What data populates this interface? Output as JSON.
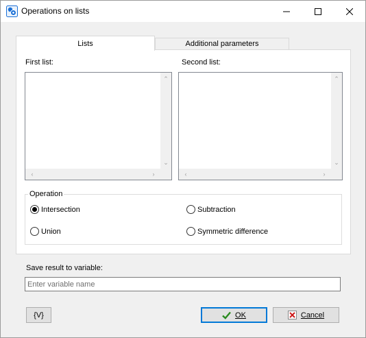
{
  "window": {
    "title": "Operations on lists",
    "icon": "operations-app-icon"
  },
  "titlebar_buttons": {
    "minimize_icon": "minimize-icon",
    "maximize_icon": "maximize-icon",
    "close_icon": "close-icon"
  },
  "tabs": [
    {
      "label": "Lists",
      "selected": true
    },
    {
      "label": "Additional parameters",
      "selected": false
    }
  ],
  "lists": {
    "first_label": "First list:",
    "second_label": "Second list:"
  },
  "operation": {
    "title": "Operation",
    "options": [
      {
        "label": "Intersection",
        "checked": true
      },
      {
        "label": "Subtraction",
        "checked": false
      },
      {
        "label": "Union",
        "checked": false
      },
      {
        "label": "Symmetric difference",
        "checked": false
      }
    ]
  },
  "result": {
    "label": "Save result to variable:",
    "placeholder": "Enter variable name",
    "value": ""
  },
  "buttons": {
    "variables": "{V}",
    "ok": "OK",
    "cancel": "Cancel"
  },
  "colors": {
    "ok_border": "#0078d7",
    "ok_check": "#2a8a1f",
    "cancel_x": "#cc1a1a",
    "app_icon": "#1a6fd6"
  }
}
